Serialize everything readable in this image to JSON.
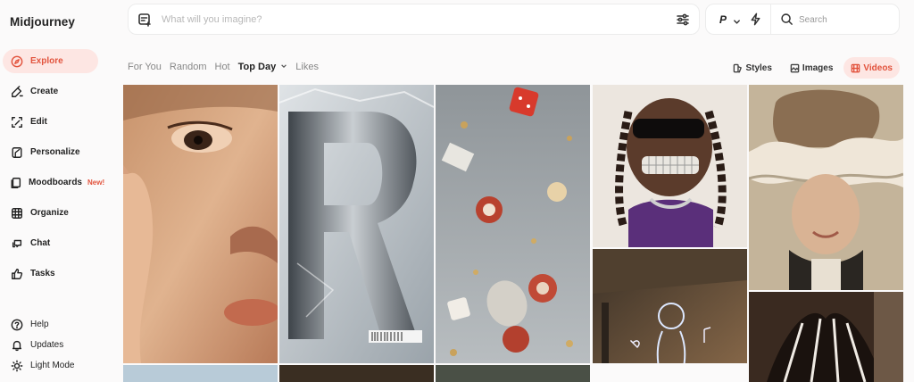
{
  "brand": "Midjourney",
  "nav": {
    "explore": "Explore",
    "create": "Create",
    "edit": "Edit",
    "personalize": "Personalize",
    "moodboards": "Moodboards",
    "moodboards_badge": "New!",
    "organize": "Organize",
    "chat": "Chat",
    "tasks": "Tasks",
    "help": "Help",
    "updates": "Updates",
    "light_mode": "Light Mode"
  },
  "prompt": {
    "placeholder": "What will you imagine?"
  },
  "controls": {
    "mode": "P",
    "search_label": "Search"
  },
  "filters": [
    "For You",
    "Random",
    "Hot",
    "Top Day",
    "Likes"
  ],
  "views": {
    "styles": "Styles",
    "images": "Images",
    "videos": "Videos"
  },
  "colors": {
    "accent": "#e2533d",
    "accent_bg": "#fde6e3"
  },
  "gallery": {
    "items": [
      "portrait-close-up-skin",
      "inflated-chrome-letter-r",
      "flying-dice-and-chips",
      "braided-character-sunglasses",
      "surreal-clouds-portrait",
      "neon-line-drawing-figure",
      "dark-feathered-wings"
    ]
  }
}
